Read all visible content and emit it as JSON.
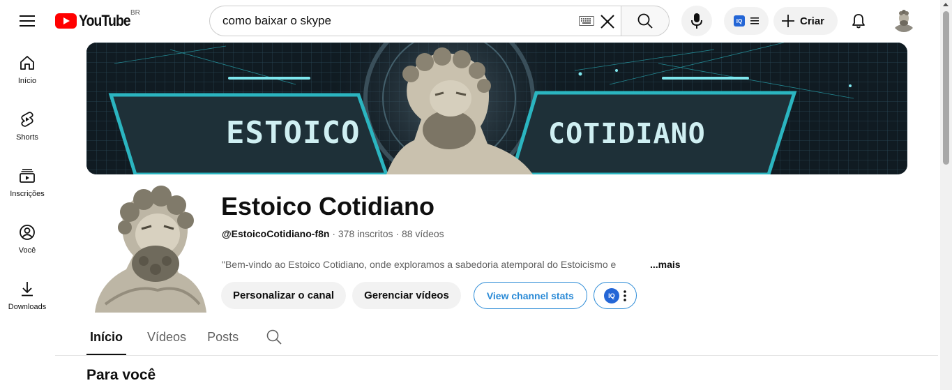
{
  "header": {
    "logo_text": "YouTube",
    "country_code": "BR",
    "search_value": "como baixar o skype",
    "create_label": "Criar",
    "ext_badge": "IQ"
  },
  "sidebar": {
    "items": [
      {
        "label": "Início",
        "icon": "home-icon"
      },
      {
        "label": "Shorts",
        "icon": "shorts-icon"
      },
      {
        "label": "Inscrições",
        "icon": "subscriptions-icon"
      },
      {
        "label": "Você",
        "icon": "you-icon"
      },
      {
        "label": "Downloads",
        "icon": "download-icon"
      }
    ]
  },
  "banner": {
    "left_text": "ESTOICO",
    "right_text": "COTIDIANO"
  },
  "channel": {
    "name": "Estoico Cotidiano",
    "handle": "@EstoicoCotidiano-f8n",
    "subscribers": "378 inscritos",
    "videos": "88 vídeos",
    "separator": "·",
    "description": "\"Bem-vindo ao Estoico Cotidiano, onde exploramos a sabedoria atemporal do Estoicismo e",
    "more_label": "...mais",
    "buttons": {
      "customize": "Personalizar o canal",
      "manage": "Gerenciar vídeos",
      "stats": "View channel stats",
      "ext_badge": "IQ"
    }
  },
  "tabs": [
    {
      "label": "Início",
      "active": true
    },
    {
      "label": "Vídeos",
      "active": false
    },
    {
      "label": "Posts",
      "active": false
    }
  ],
  "section": {
    "title": "Para você"
  },
  "colors": {
    "youtube_red": "#ff0000",
    "accent_blue": "#2a8ad6",
    "banner_cyan": "#2bb5c0",
    "banner_dark": "#1e3038",
    "banner_text": "#cfeff2"
  }
}
